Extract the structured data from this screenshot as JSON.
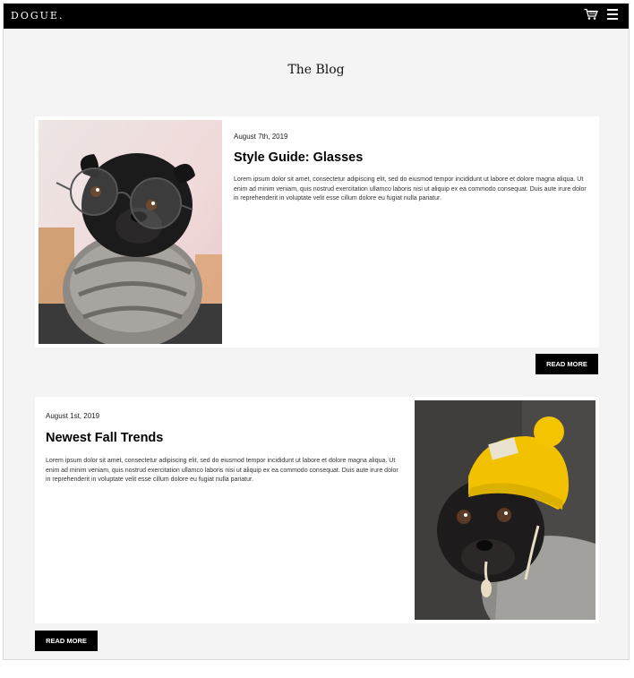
{
  "header": {
    "logo": "DOGUE.",
    "icons": [
      "cart-icon",
      "menu-icon"
    ]
  },
  "page": {
    "title": "The Blog"
  },
  "posts": [
    {
      "date": "August 7th, 2019",
      "title": "Style Guide: Glasses",
      "excerpt": "Lorem ipsum dolor sit amet, consectetur adipiscing elit, sed do eiusmod tempor incididunt ut labore et dolore magna aliqua. Ut enim ad minim veniam, quis nostrud exercitation ullamco laboris nisi ut aliquip ex ea commodo consequat. Duis aute irure dolor in reprehenderit in voluptate velit esse cillum dolore eu fugiat nulla pariatur.",
      "image": "pug-with-glasses",
      "button": "READ MORE"
    },
    {
      "date": "August 1st, 2019",
      "title": "Newest Fall Trends",
      "excerpt": "Lorem ipsum dolor sit amet, consectetur adipiscing elit, sed do eiusmod tempor incididunt ut labore et dolore magna aliqua. Ut enim ad minim veniam, quis nostrud exercitation ullamco laboris nisi ut aliquip ex ea commodo consequat. Duis aute irure dolor in reprehenderit in voluptate velit esse cillum dolore eu fugiat nulla pariatur.",
      "image": "pug-with-yellow-beanie",
      "button": "READ MORE"
    }
  ],
  "colors": {
    "header": "#000000",
    "page_background": "#f4f4f4",
    "card": "#ffffff",
    "button": "#000000",
    "beanie": "#f2c200"
  }
}
